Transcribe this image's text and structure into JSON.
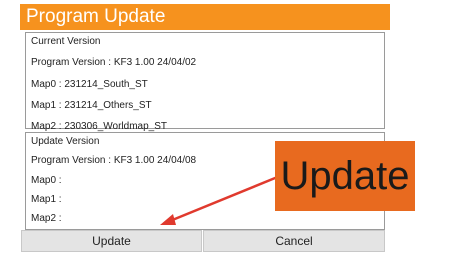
{
  "dialog": {
    "title": "Program Update",
    "accent_color": "#f6921e",
    "current": {
      "header": "Current Version",
      "program_version": "Program Version : KF3 1.00 24/04/02",
      "map0": "Map0 : 231214_South_ST",
      "map1": "Map1 : 231214_Others_ST",
      "map2": "Map2 : 230306_Worldmap_ST"
    },
    "update": {
      "header": "Update Version",
      "program_version": "Program Version : KF3 1.00 24/04/08",
      "map0": "Map0 :",
      "map1": "Map1 :",
      "map2": "Map2 :"
    },
    "buttons": {
      "update_label": "Update",
      "cancel_label": "Cancel"
    }
  },
  "annotation": {
    "label": "Update",
    "color": "#e86a1f",
    "arrow_color": "#e03a2e"
  }
}
